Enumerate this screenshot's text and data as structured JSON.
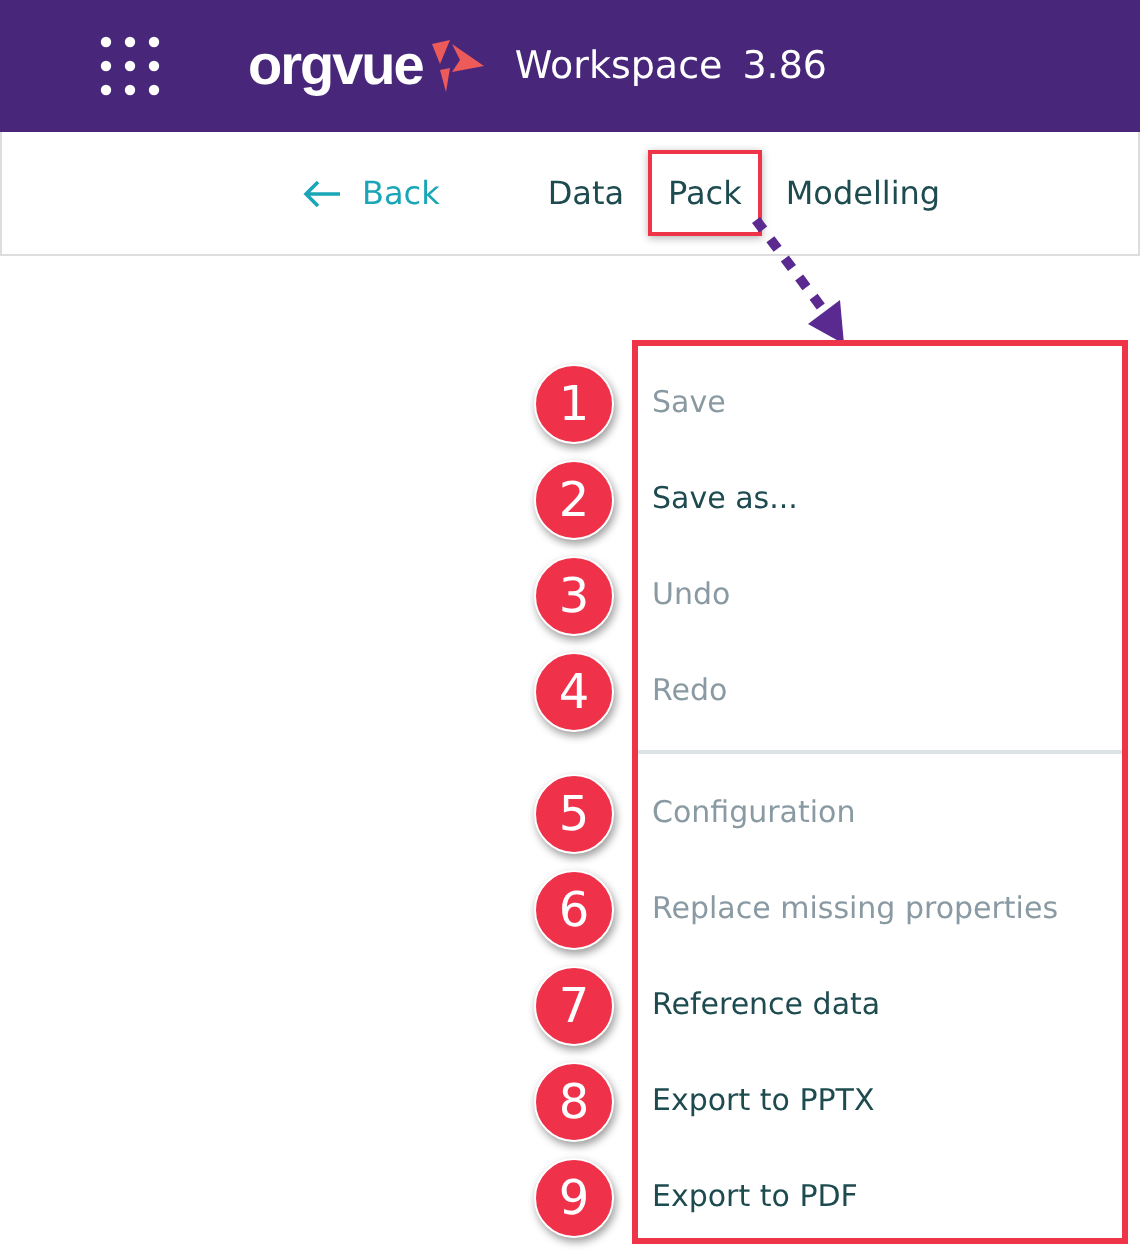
{
  "header": {
    "logo": "orgvue",
    "title": "Workspace",
    "version": "3.86"
  },
  "nav": {
    "back": "Back",
    "tabs": [
      {
        "label": "Data",
        "highlighted": false
      },
      {
        "label": "Pack",
        "highlighted": true
      },
      {
        "label": "Modelling",
        "highlighted": false
      }
    ]
  },
  "menu": {
    "groups": [
      [
        {
          "number": "1",
          "label": "Save",
          "disabled": true
        },
        {
          "number": "2",
          "label": "Save as...",
          "disabled": false
        },
        {
          "number": "3",
          "label": "Undo",
          "disabled": true
        },
        {
          "number": "4",
          "label": "Redo",
          "disabled": true
        }
      ],
      [
        {
          "number": "5",
          "label": "Configuration",
          "disabled": true
        },
        {
          "number": "6",
          "label": "Replace missing properties",
          "disabled": true
        },
        {
          "number": "7",
          "label": "Reference data",
          "disabled": false
        },
        {
          "number": "8",
          "label": "Export to PPTX",
          "disabled": false
        },
        {
          "number": "9",
          "label": "Export to PDF",
          "disabled": false
        }
      ]
    ]
  }
}
